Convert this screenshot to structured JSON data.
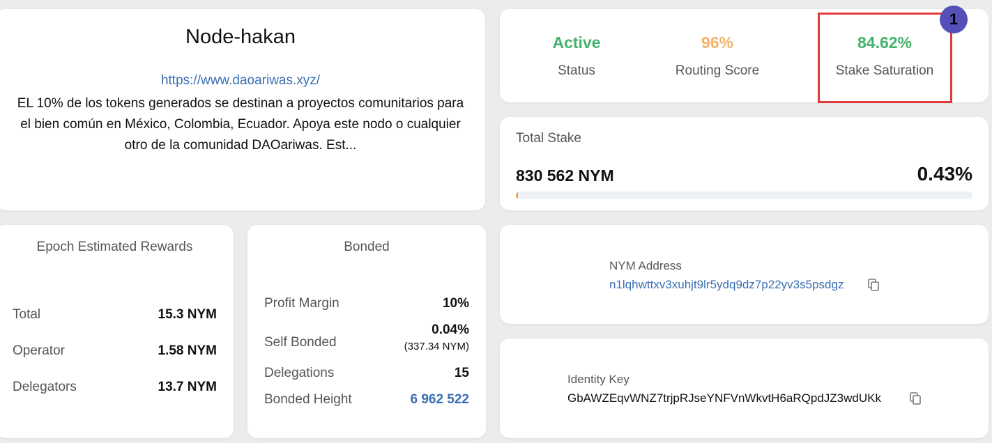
{
  "node": {
    "title": "Node-hakan",
    "url": "https://www.daoariwas.xyz/",
    "description": "EL 10% de los tokens generados se destinan a proyectos comunitarios para el bien común en México, Colombia, Ecuador. Apoya este nodo o cualquier otro de la comunidad DAOariwas. Est..."
  },
  "stats": {
    "status": {
      "value": "Active",
      "label": "Status",
      "color": "#43b26a"
    },
    "routing": {
      "value": "96%",
      "label": "Routing Score",
      "color": "#f4b26b"
    },
    "saturation": {
      "value": "84.62%",
      "label": "Stake Saturation",
      "color": "#43b26a"
    }
  },
  "annotation": {
    "badge": "1",
    "highlight_color": "#e03a3a",
    "badge_color": "#5450b8"
  },
  "total_stake": {
    "label": "Total Stake",
    "amount": "830 562 NYM",
    "percent": "0.43%",
    "progress_fraction": 0.0043
  },
  "rewards": {
    "heading": "Epoch Estimated Rewards",
    "rows": [
      {
        "label": "Total",
        "value": "15.3 NYM"
      },
      {
        "label": "Operator",
        "value": "1.58 NYM"
      },
      {
        "label": "Delegators",
        "value": "13.7 NYM"
      }
    ]
  },
  "bonded": {
    "heading": "Bonded",
    "profit_margin": {
      "label": "Profit Margin",
      "value": "10%"
    },
    "self_bonded": {
      "label": "Self Bonded",
      "value": "0.04%",
      "sub": "(337.34 NYM)"
    },
    "delegations": {
      "label": "Delegations",
      "value": "15"
    },
    "bonded_height": {
      "label": "Bonded Height",
      "value": "6 962 522"
    }
  },
  "nym_address": {
    "label": "NYM Address",
    "value": "n1lqhwttxv3xuhjt9lr5ydq9dz7p22yv3s5psdgz",
    "icon": "copy-icon"
  },
  "identity_key": {
    "label": "Identity Key",
    "value": "GbAWZEqvWNZ7trjpRJseYNFVnWkvtH6aRQpdJZ3wdUKk",
    "icon": "copy-icon"
  }
}
